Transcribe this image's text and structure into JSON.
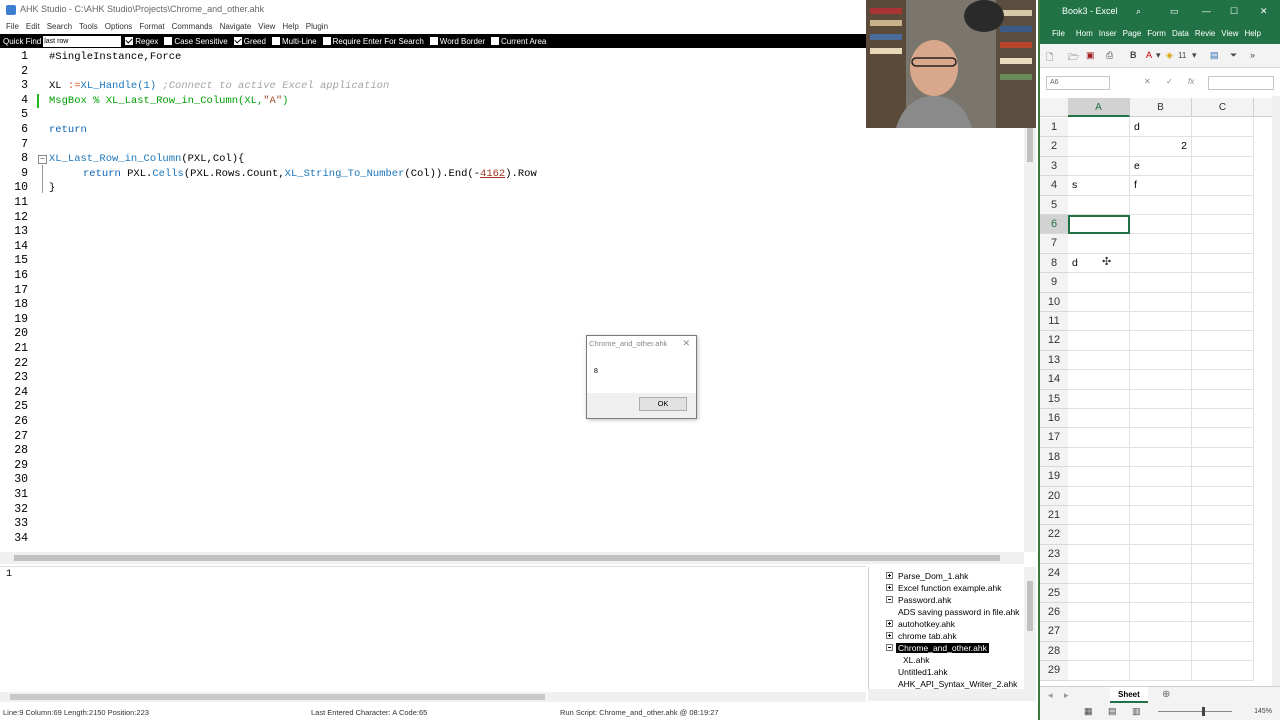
{
  "ahk": {
    "title": "AHK Studio - C:\\AHK Studio\\Projects\\Chrome_and_other.ahk",
    "menu": [
      "File",
      "Edit",
      "Search",
      "Tools",
      "Options",
      "Format",
      "Commands",
      "Navigate",
      "View",
      "Help",
      "Plugin"
    ],
    "quickfind": {
      "label": "Quick Find",
      "value": "last row",
      "options": [
        {
          "label": "Regex",
          "checked": true
        },
        {
          "label": "Case Sensitive",
          "checked": false
        },
        {
          "label": "Greed",
          "checked": true
        },
        {
          "label": "Multi-Line",
          "checked": false
        },
        {
          "label": "Require Enter For Search",
          "checked": false
        },
        {
          "label": "Word Border",
          "checked": false
        },
        {
          "label": "Current Area",
          "checked": false
        }
      ]
    },
    "line_numbers": [
      "1",
      "2",
      "3",
      "4",
      "5",
      "6",
      "7",
      "8",
      "9",
      "10",
      "11",
      "12",
      "13",
      "14",
      "15",
      "16",
      "17",
      "18",
      "19",
      "20",
      "21",
      "22",
      "23",
      "24",
      "25",
      "26",
      "27",
      "28",
      "29",
      "30",
      "31",
      "32",
      "33",
      "34"
    ],
    "code": {
      "l1": "#SingleInstance,Force",
      "l3_var": "XL ",
      "l3_op": ":=",
      "l3_fn": "XL_Handle(1)",
      "l3_cmt": " ;Connect to active Excel application",
      "l4_cmd": "MsgBox % ",
      "l4_fn": "XL_Last_Row_in_Column(XL,",
      "l4_str": "\"A\"",
      "l4_end": ")",
      "l6": "return",
      "l8_fn": "XL_Last_Row_in_Column",
      "l8_rest": "(PXL,Col){",
      "l9_kw": "return ",
      "l9_a": "PXL.",
      "l9_b": "Cells",
      "l9_c": "(PXL.Rows.Count,",
      "l9_d": "XL_String_To_Number",
      "l9_e": "(Col)).End(-",
      "l9_num": "4162",
      "l9_f": ").Row",
      "l10": "}"
    },
    "output_line": "1",
    "tree": [
      {
        "label": "Parse_Dom_1.ahk",
        "level": 0,
        "expander": "plus",
        "selected": false
      },
      {
        "label": "Excel function example.ahk",
        "level": 0,
        "expander": "plus",
        "selected": false
      },
      {
        "label": "Password.ahk",
        "level": 0,
        "expander": "minus",
        "selected": false
      },
      {
        "label": "ADS saving password in file.ahk",
        "level": 0,
        "expander": "none",
        "selected": false
      },
      {
        "label": "autohotkey.ahk",
        "level": 0,
        "expander": "plus",
        "selected": false
      },
      {
        "label": "chrome tab.ahk",
        "level": 0,
        "expander": "plus",
        "selected": false
      },
      {
        "label": "Chrome_and_other.ahk",
        "level": 0,
        "expander": "minus",
        "selected": true
      },
      {
        "label": "XL.ahk",
        "level": 1,
        "expander": "none",
        "selected": false
      },
      {
        "label": "Untitled1.ahk",
        "level": 0,
        "expander": "none",
        "selected": false
      },
      {
        "label": "AHK_API_Syntax_Writer_2.ahk",
        "level": 0,
        "expander": "none",
        "selected": false
      }
    ],
    "status": {
      "position": "Line:9 Column:69 Length:2150 Position:223",
      "last_char": "Last Entered Character: A Code:65",
      "run": "Run Script: Chrome_and_other.ahk @ 08:19:27"
    }
  },
  "msgbox": {
    "title": "Chrome_and_other.ahk",
    "text": "8",
    "ok": "OK"
  },
  "excel": {
    "title": "Book3 - Excel",
    "tabs": [
      "File",
      "Hom",
      "Inser",
      "Page",
      "Form",
      "Data",
      "Revie",
      "View",
      "Help"
    ],
    "font_size": "11",
    "name_box": "A6",
    "fx_label": "fx",
    "columns": [
      "A",
      "B",
      "C"
    ],
    "rows": [
      "1",
      "2",
      "3",
      "4",
      "5",
      "6",
      "7",
      "8",
      "9",
      "10",
      "11",
      "12",
      "13",
      "14",
      "15",
      "16",
      "17",
      "18",
      "19",
      "20",
      "21",
      "22",
      "23",
      "24",
      "25",
      "26",
      "27",
      "28",
      "29"
    ],
    "cells": {
      "B1": "d",
      "B2": "2",
      "B3": "e",
      "A4": "s",
      "B4": "f",
      "A8": "d"
    },
    "active_cell": "A6",
    "sheet_tab": "Sheet",
    "zoom": "145%",
    "accent": "#217346"
  }
}
